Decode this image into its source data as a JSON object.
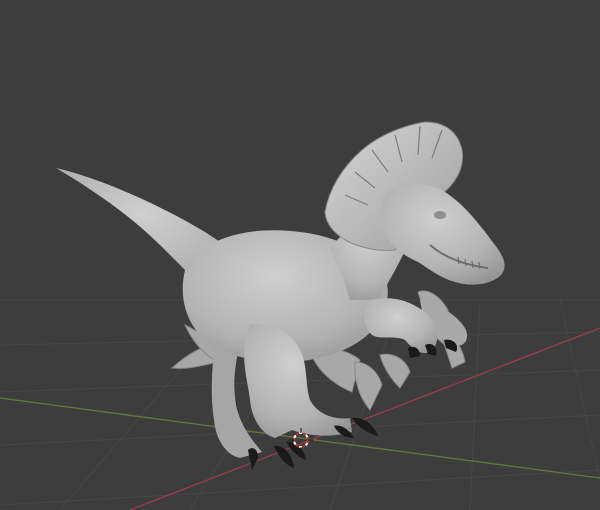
{
  "viewport": {
    "background": "#3d3d3d",
    "grid_color": "#474747",
    "x_axis_color": "#9b3b45",
    "y_axis_color": "#5f7a3a",
    "model_color": "#b8b8b8",
    "claw_color": "#1a1a1a",
    "cursor_colors": [
      "#c0302a",
      "#ffffff"
    ],
    "objects": [
      "dinosaur-model"
    ],
    "icons": [
      "3d-cursor-icon"
    ]
  }
}
